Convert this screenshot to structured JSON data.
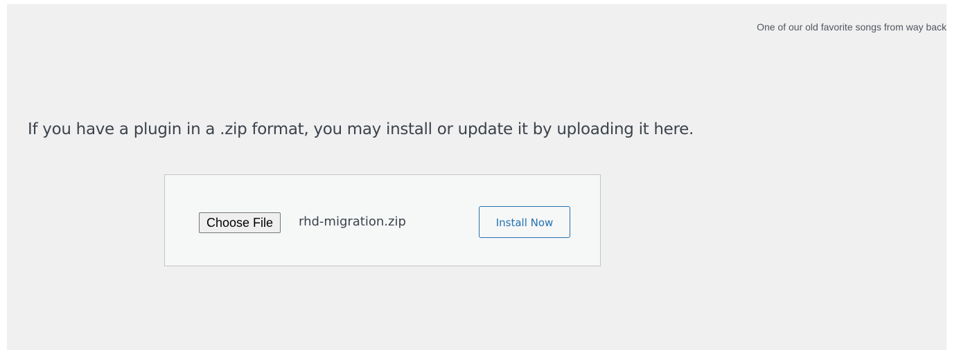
{
  "hello_dolly": {
    "lyric": "One of our old favorite songs from way back"
  },
  "upload": {
    "help_text": "If you have a plugin in a .zip format, you may install or update it by uploading it here.",
    "choose_file_label": "Choose File",
    "selected_file": "rhd-migration.zip",
    "install_label": "Install Now"
  },
  "colors": {
    "background": "#f0f0f1",
    "box_background": "#f6f7f7",
    "box_border": "#c3c4c7",
    "accent": "#2271b1",
    "text": "#3c434a"
  }
}
